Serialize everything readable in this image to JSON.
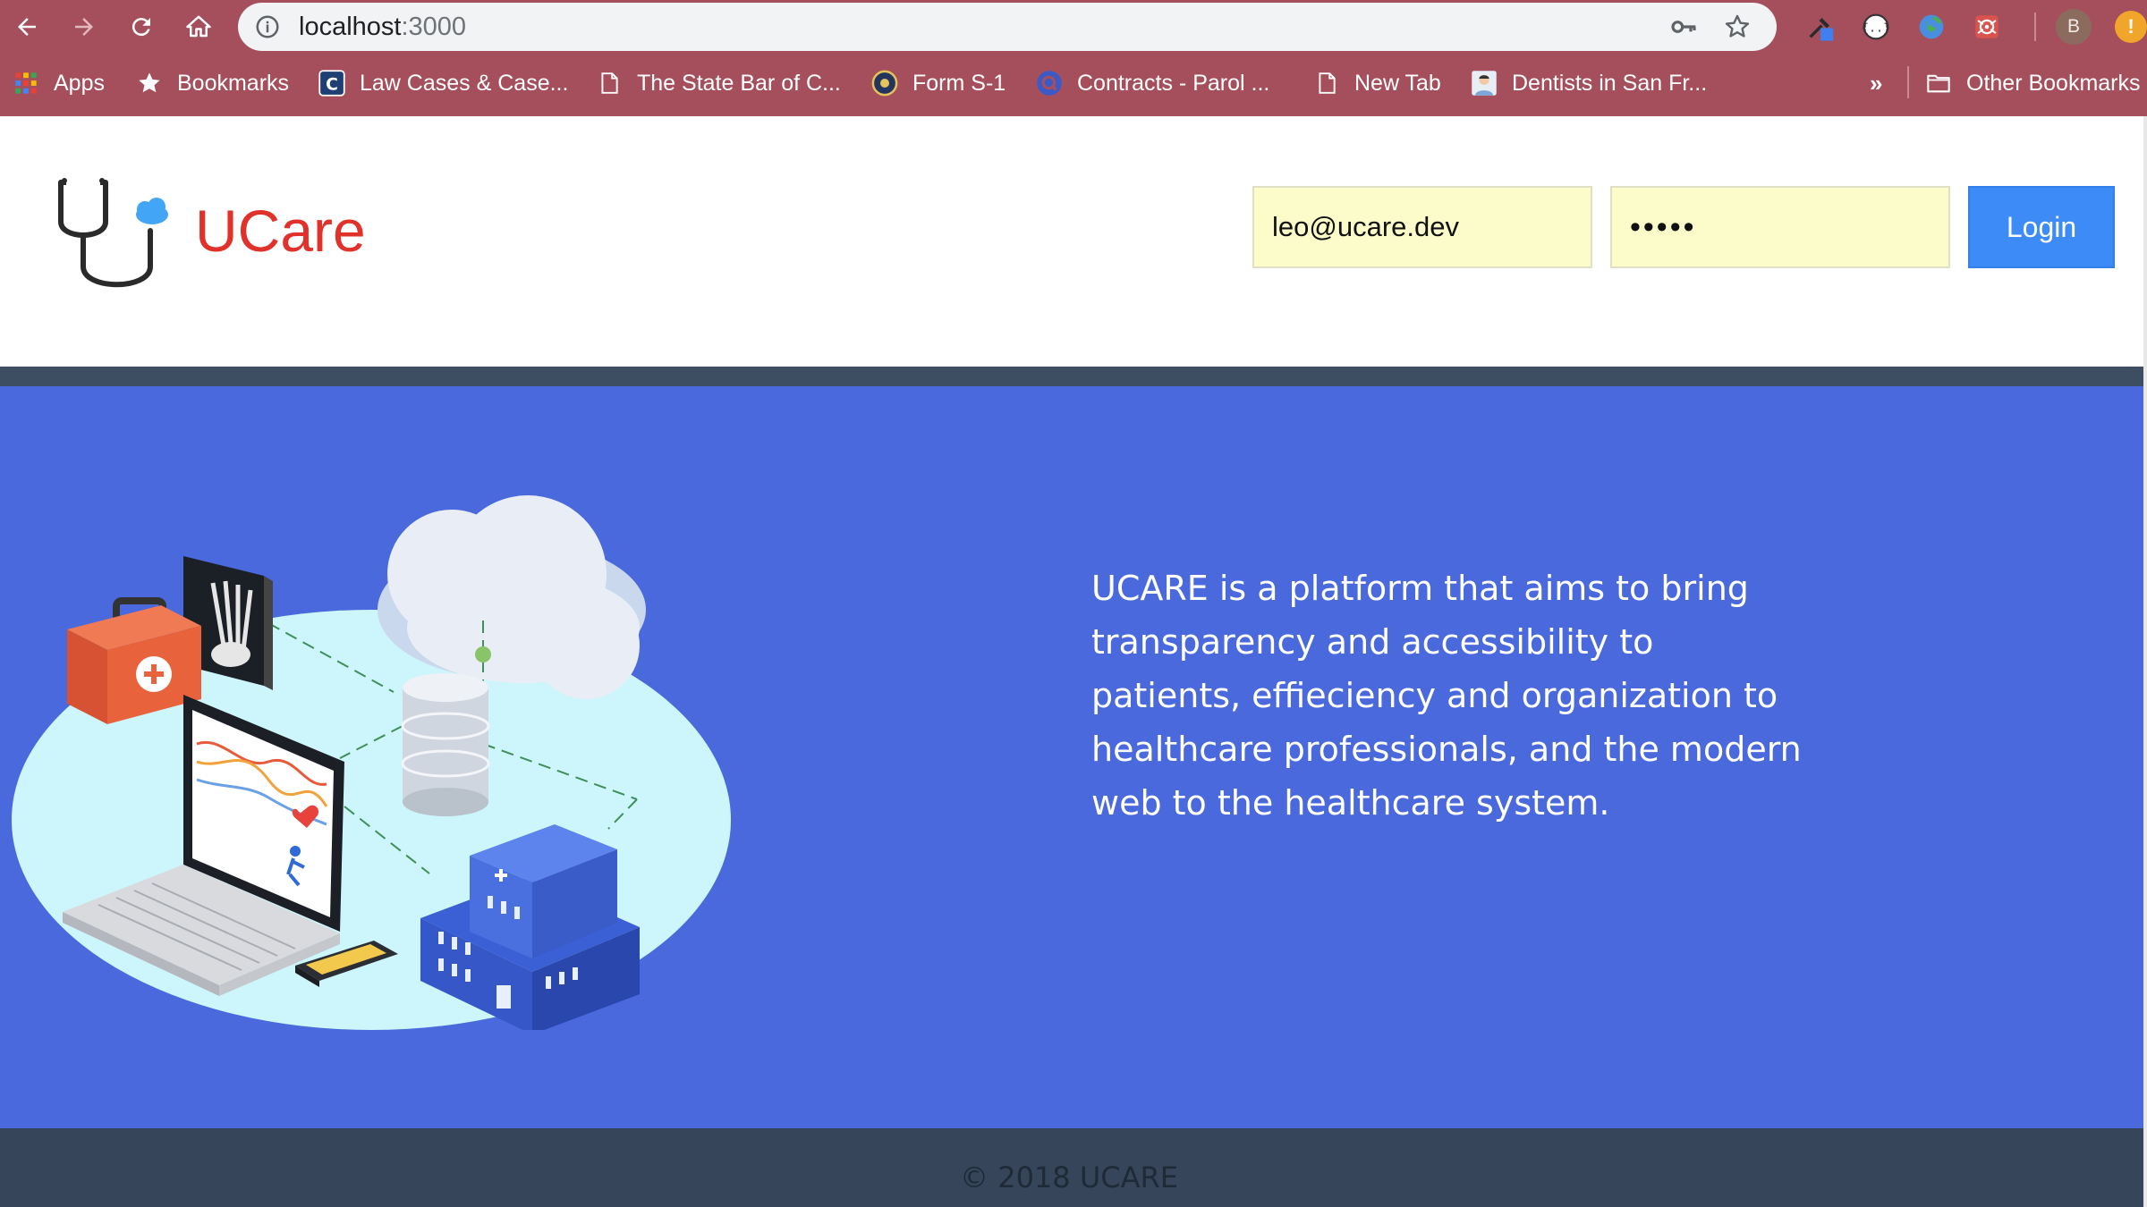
{
  "browser": {
    "url_host": "localhost",
    "url_port": ":3000",
    "bookmarks": [
      {
        "label": "Apps",
        "icon": "apps-grid-icon"
      },
      {
        "label": "Bookmarks",
        "icon": "star-icon"
      },
      {
        "label": "Law Cases & Case...",
        "icon": "casetext-icon"
      },
      {
        "label": "The State Bar of C...",
        "icon": "page-icon"
      },
      {
        "label": "Form S-1",
        "icon": "sec-seal-icon"
      },
      {
        "label": "Contracts - Parol ...",
        "icon": "quizlet-icon"
      },
      {
        "label": "New Tab",
        "icon": "page-icon"
      },
      {
        "label": "Dentists in San Fr...",
        "icon": "dentist-icon"
      }
    ],
    "overflow": "»",
    "other_bookmarks": "Other Bookmarks",
    "profile_initial": "B",
    "alert_symbol": "!"
  },
  "header": {
    "brand": "UCare",
    "email_value": "leo@ucare.dev",
    "password_value": "•••••",
    "login_label": "Login"
  },
  "hero": {
    "blurb": "UCARE is a platform that aims to bring transparency and accessibility to patients, effieciency and organization to healthcare professionals, and the modern web to the healthcare system."
  },
  "footer": {
    "copyright": "© 2018 UCARE"
  },
  "colors": {
    "chrome": "#a54f5c",
    "brand": "#e0322a",
    "login_button": "#3d8bf6",
    "hero_bg": "#4a69dc",
    "footer_bg": "#364559"
  }
}
